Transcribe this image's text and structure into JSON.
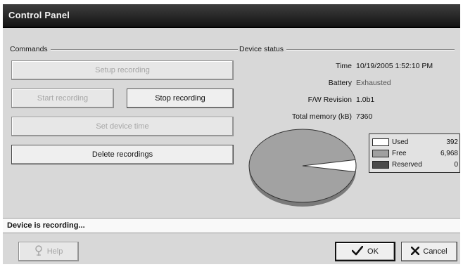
{
  "window": {
    "title": "Control Panel"
  },
  "commands": {
    "group_label": "Commands",
    "setup_recording": "Setup recording",
    "start_recording": "Start recording",
    "stop_recording": "Stop recording",
    "set_device_time": "Set device time",
    "delete_recordings": "Delete recordings"
  },
  "device_status": {
    "group_label": "Device status",
    "fields": [
      {
        "label": "Time",
        "value": "10/19/2005 1:52:10 PM"
      },
      {
        "label": "Battery",
        "value": "Exhausted"
      },
      {
        "label": "F/W Revision",
        "value": "1.0b1"
      },
      {
        "label": "Total memory (kB)",
        "value": "7360"
      }
    ]
  },
  "memory_legend": [
    {
      "name": "Used",
      "value": "392",
      "color": "#ffffff"
    },
    {
      "name": "Free",
      "value": "6,968",
      "color": "#a0a0a0"
    },
    {
      "name": "Reserved",
      "value": "0",
      "color": "#4a4a4a"
    }
  ],
  "memory_chart": {
    "used": 392,
    "free": 6968,
    "reserved": 0
  },
  "status_message": "Device is recording...",
  "footer": {
    "help_label": "Help",
    "ok_label": "OK",
    "cancel_label": "Cancel"
  }
}
